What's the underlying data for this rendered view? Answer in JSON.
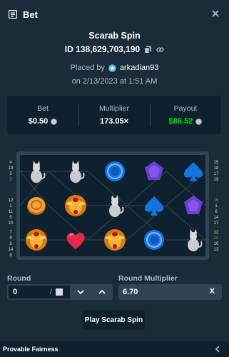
{
  "header": {
    "title": "Bet"
  },
  "bet": {
    "game": "Scarab Spin",
    "id": "ID 138,629,703,190",
    "placed_by_prefix": "Placed by",
    "user": "arkadian93",
    "date": "on 2/13/2023 at 1:51 AM"
  },
  "stats": {
    "bet_label": "Bet",
    "bet_value": "$0.50",
    "multiplier_label": "Multiplier",
    "multiplier_value": "173.05×",
    "payout_label": "Payout",
    "payout_value": "$86.52"
  },
  "board": {
    "rows": [
      [
        "cat",
        "cat",
        "blue-circle",
        "purple-pentagon",
        "blue-spade"
      ],
      [
        "coin",
        "scarab",
        "cat",
        "blue-spade",
        "purple-pentagon"
      ],
      [
        "scarab",
        "heart",
        "scarab",
        "blue-circle",
        "cat"
      ]
    ],
    "left_numbers": [
      [
        "4",
        "13",
        "3",
        "2"
      ],
      [
        "12",
        "1",
        "11",
        "5",
        "10"
      ],
      [
        "7",
        "9",
        "3",
        "14",
        "8"
      ]
    ],
    "right_numbers": [
      [
        "15",
        "18",
        "17",
        "19"
      ],
      [
        "16",
        "1",
        "6",
        "14",
        "17"
      ],
      [
        "12",
        "20",
        "10",
        "13"
      ]
    ],
    "green_left": [
      "2"
    ],
    "green_right": [
      "16",
      "20"
    ]
  },
  "round": {
    "label": "Round",
    "value": "0",
    "slash": "/"
  },
  "round_multiplier": {
    "label": "Round Multiplier",
    "value": "6.70",
    "clear": "X"
  },
  "play_button": "Play Scarab Spin",
  "footer": {
    "label": "Provable Fairness"
  },
  "colors": {
    "bg": "#1a2c38",
    "panel": "#0f212e",
    "border": "#2f4553",
    "muted": "#b1bad3",
    "green": "#00e701",
    "blue": "#1475e1",
    "purple": "#6b3fd6"
  }
}
